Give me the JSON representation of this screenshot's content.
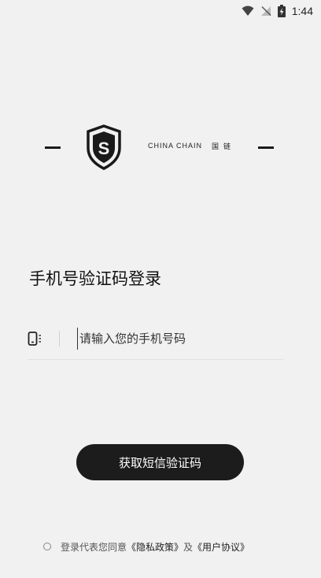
{
  "status_bar": {
    "time": "1:44",
    "icons": [
      "wifi-icon",
      "signal-off-icon",
      "battery-charging-icon"
    ]
  },
  "brand": {
    "name_en": "CHINA CHAIN",
    "name_cn": "国链",
    "logo_letter": "S"
  },
  "login": {
    "title": "手机号验证码登录",
    "phone_placeholder": "请输入您的手机号码",
    "phone_value": "",
    "get_code_label": "获取短信验证码"
  },
  "agreement": {
    "prefix": "登录代表您同意",
    "privacy_label": "《隐私政策》",
    "and_text": "及",
    "terms_label": "《用户协议》",
    "checked": false
  },
  "colors": {
    "background": "#f1f1f1",
    "button": "#1c1c1c",
    "button_text": "#ffffff"
  }
}
